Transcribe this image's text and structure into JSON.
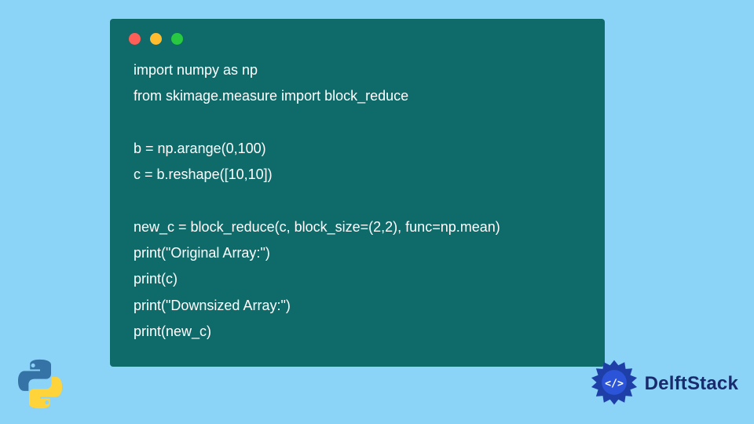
{
  "colors": {
    "page_bg": "#8bd3f7",
    "card_bg": "#0f6a6a",
    "code_fg": "#ffffff",
    "brand_fg": "#1a2b6d",
    "dot_red": "#ff5f57",
    "dot_yellow": "#febc2e",
    "dot_green": "#28c840"
  },
  "code": {
    "lines": [
      "import numpy as np",
      "from skimage.measure import block_reduce",
      "",
      "b = np.arange(0,100)",
      "c = b.reshape([10,10])",
      "",
      "new_c = block_reduce(c, block_size=(2,2), func=np.mean)",
      "print(\"Original Array:\")",
      "print(c)",
      "print(\"Downsized Array:\")",
      "print(new_c)"
    ]
  },
  "brand": {
    "name": "DelftStack"
  },
  "icons": {
    "python": "python-logo-icon",
    "brand_badge": "delftstack-gear-icon"
  }
}
